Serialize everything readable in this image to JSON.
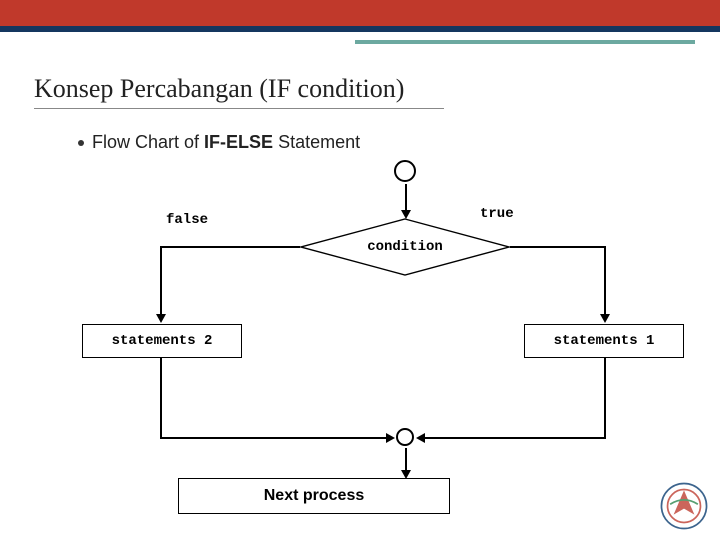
{
  "header": {
    "title": "Konsep Percabangan (IF condition)"
  },
  "bullet": {
    "prefix": "Flow Chart of ",
    "bold": "IF-ELSE",
    "suffix": " Statement"
  },
  "diagram": {
    "true_label": "true",
    "false_label": "false",
    "condition": "condition",
    "statements_false": "statements 2",
    "statements_true": "statements 1",
    "next_process": "Next process"
  }
}
